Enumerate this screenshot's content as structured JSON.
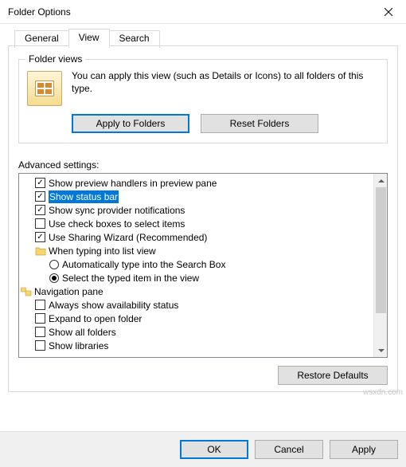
{
  "window": {
    "title": "Folder Options"
  },
  "tabs": {
    "general": "General",
    "view": "View",
    "search": "Search"
  },
  "folder_views": {
    "legend": "Folder views",
    "desc": "You can apply this view (such as Details or Icons) to all folders of this type.",
    "apply_btn": "Apply to Folders",
    "reset_btn": "Reset Folders"
  },
  "advanced": {
    "label": "Advanced settings:",
    "items": {
      "preview_handlers": "Show preview handlers in preview pane",
      "status_bar": "Show status bar",
      "sync_notif": "Show sync provider notifications",
      "check_boxes": "Use check boxes to select items",
      "sharing_wizard": "Use Sharing Wizard (Recommended)",
      "typing_group": "When typing into list view",
      "typing_auto": "Automatically type into the Search Box",
      "typing_select": "Select the typed item in the view",
      "nav_pane": "Navigation pane",
      "always_avail": "Always show availability status",
      "expand_open": "Expand to open folder",
      "show_all": "Show all folders",
      "show_libs": "Show libraries"
    },
    "restore_btn": "Restore Defaults"
  },
  "dialog_buttons": {
    "ok": "OK",
    "cancel": "Cancel",
    "apply": "Apply"
  },
  "watermark": "wsxdn.com"
}
